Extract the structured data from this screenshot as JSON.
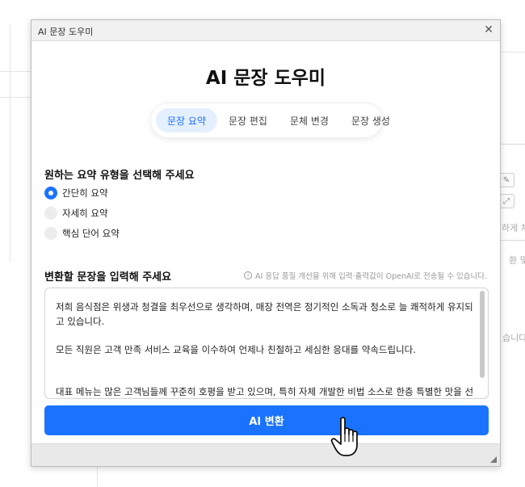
{
  "background": {
    "right_text_1": "하게 처",
    "right_text_2": "환 및",
    "right_text_3": "습니다"
  },
  "dialog": {
    "title": "AI 문장 도우미",
    "close_glyph": "✕",
    "heading": "AI 문장 도우미",
    "tabs": [
      {
        "label": "문장 요약",
        "active": true
      },
      {
        "label": "문장 편집",
        "active": false
      },
      {
        "label": "문체 변경",
        "active": false
      },
      {
        "label": "문장 생성",
        "active": false
      }
    ],
    "summary_type": {
      "label": "원하는 요약 유형을 선택해 주세요",
      "options": [
        {
          "label": "간단히 요약",
          "checked": true
        },
        {
          "label": "자세히 요약",
          "checked": false
        },
        {
          "label": "핵심 단어 요약",
          "checked": false
        }
      ]
    },
    "input": {
      "label": "변환할 문장을 입력해 주세요",
      "notice": "AI 응답 품질 개선을 위해 입력·출력값이 OpenAI로 전송될 수 있습니다.",
      "paragraphs": [
        "저희 음식점은 위생과 청결을 최우선으로 생각하며, 매장 전역은 정기적인 소독과 청소로 늘 쾌적하게 유지되고 있습니다.",
        "모든 직원은 고객 만족 서비스 교육을 이수하여 언제나 친절하고 세심한 응대를 약속드립니다.",
        "대표 메뉴는 많은 고객님들께 꾸준히 호평을 받고 있으며, 특히 자체 개발한 비법 소스로 한층 특별한 맛을 선사합니다."
      ]
    },
    "convert_button": "AI 변환"
  },
  "colors": {
    "accent": "#1a73ff",
    "tab_active_bg": "#e5f0ff",
    "radio_unchecked": "#ececec"
  }
}
